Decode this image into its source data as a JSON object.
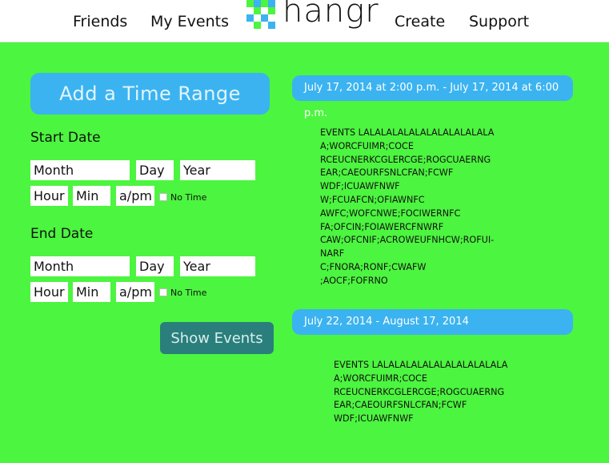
{
  "nav": {
    "friends": "Friends",
    "my_events": "My Events",
    "create": "Create",
    "support": "Support"
  },
  "logo": {
    "text": "hangr",
    "colors": [
      "#4cf53f",
      "#3bb3f0"
    ]
  },
  "time_range": {
    "add_label": "Add a Time Range",
    "start_label": "Start Date",
    "end_label": "End Date",
    "month_placeholder": "Month",
    "day_placeholder": "Day",
    "year_placeholder": "Year",
    "hour_placeholder": "Hour",
    "min_placeholder": "Min",
    "ampm_placeholder": "a/pm",
    "no_time_label": "No Time",
    "show_events_label": "Show Events"
  },
  "ranges": [
    {
      "label": "July 17, 2014 at 2:00 p.m. - July 17, 2014 at 6:00 p.m.",
      "lines": [
        "EVENTS LALALALALALALALALALALALA",
        "A;WORCFUIMR;COCE",
        "RCEUCNERKCGLERCGE;ROGCUAERNG",
        "EAR;CAEOURFSNLCFAN;FCWF",
        "WDF;ICUAWFNWF",
        "W;FCUAFCN;OFIAWNFC",
        "AWFC;WOFCNWE;FOCIWERNFC",
        "FA;OFCIN;FOIAWERCFNWRF",
        "CAW;OFCNIF;ACROWEUFNHCW;ROFUI-",
        "NARF",
        "C;FNORA;RONF;CWAFW",
        ";AOCF;FOFRNO"
      ]
    },
    {
      "label": "July 22, 2014 - August 17, 2014",
      "lines": [
        "EVENTS LALALALALALALALALALALALA",
        "A;WORCFUIMR;COCE",
        "RCEUCNERKCGLERCGE;ROGCUAERNG",
        "EAR;CAEOURFSNLCFAN;FCWF",
        "WDF;ICUAWFNWF"
      ]
    }
  ]
}
